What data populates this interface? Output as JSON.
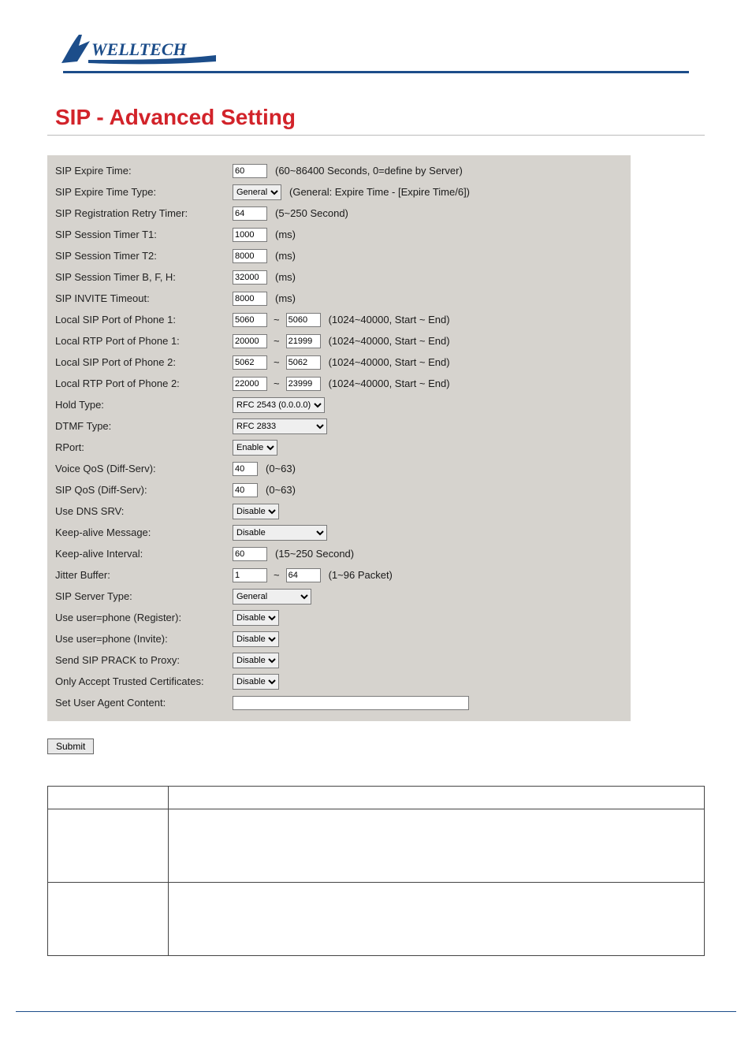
{
  "brand": "WELLTECH",
  "title": "SIP - Advanced Setting",
  "rows": {
    "expire_time": {
      "label": "SIP Expire Time:",
      "value": "60",
      "hint": "(60~86400 Seconds, 0=define by Server)"
    },
    "expire_type": {
      "label": "SIP Expire Time Type:",
      "value": "General",
      "hint": "(General: Expire Time - [Expire Time/6])"
    },
    "retry_timer": {
      "label": "SIP Registration Retry Timer:",
      "value": "64",
      "hint": "(5~250 Second)"
    },
    "t1": {
      "label": "SIP Session Timer T1:",
      "value": "1000",
      "hint": "(ms)"
    },
    "t2": {
      "label": "SIP Session Timer T2:",
      "value": "8000",
      "hint": "(ms)"
    },
    "tbfh": {
      "label": "SIP Session Timer B, F, H:",
      "value": "32000",
      "hint": "(ms)"
    },
    "invite_to": {
      "label": "SIP INVITE Timeout:",
      "value": "8000",
      "hint": "(ms)"
    },
    "sip_port1": {
      "label": "Local SIP Port of Phone 1:",
      "start": "5060",
      "end": "5060",
      "hint": "(1024~40000, Start ~ End)"
    },
    "rtp_port1": {
      "label": "Local RTP Port of Phone 1:",
      "start": "20000",
      "end": "21999",
      "hint": "(1024~40000, Start ~ End)"
    },
    "sip_port2": {
      "label": "Local SIP Port of Phone 2:",
      "start": "5062",
      "end": "5062",
      "hint": "(1024~40000, Start ~ End)"
    },
    "rtp_port2": {
      "label": "Local RTP Port of Phone 2:",
      "start": "22000",
      "end": "23999",
      "hint": "(1024~40000, Start ~ End)"
    },
    "hold_type": {
      "label": "Hold Type:",
      "value": "RFC 2543 (0.0.0.0)"
    },
    "dtmf_type": {
      "label": "DTMF Type:",
      "value": "RFC 2833"
    },
    "rport": {
      "label": "RPort:",
      "value": "Enable"
    },
    "voice_qos": {
      "label": "Voice QoS (Diff-Serv):",
      "value": "40",
      "hint": "(0~63)"
    },
    "sip_qos": {
      "label": "SIP QoS (Diff-Serv):",
      "value": "40",
      "hint": "(0~63)"
    },
    "dns_srv": {
      "label": "Use DNS SRV:",
      "value": "Disable"
    },
    "keepalive_msg": {
      "label": "Keep-alive Message:",
      "value": "Disable"
    },
    "keepalive_int": {
      "label": "Keep-alive Interval:",
      "value": "60",
      "hint": "(15~250 Second)"
    },
    "jitter": {
      "label": "Jitter Buffer:",
      "start": "1",
      "end": "64",
      "hint": "(1~96 Packet)"
    },
    "server_type": {
      "label": "SIP Server Type:",
      "value": "General"
    },
    "userphone_reg": {
      "label": "Use user=phone (Register):",
      "value": "Disable"
    },
    "userphone_inv": {
      "label": "Use user=phone (Invite):",
      "value": "Disable"
    },
    "send_prack": {
      "label": "Send SIP PRACK to Proxy:",
      "value": "Disable"
    },
    "trusted_cert": {
      "label": "Only Accept Trusted Certificates:",
      "value": "Disable"
    },
    "user_agent": {
      "label": "Set User Agent Content:",
      "value": ""
    }
  },
  "submit_label": "Submit",
  "range_sep": "~"
}
